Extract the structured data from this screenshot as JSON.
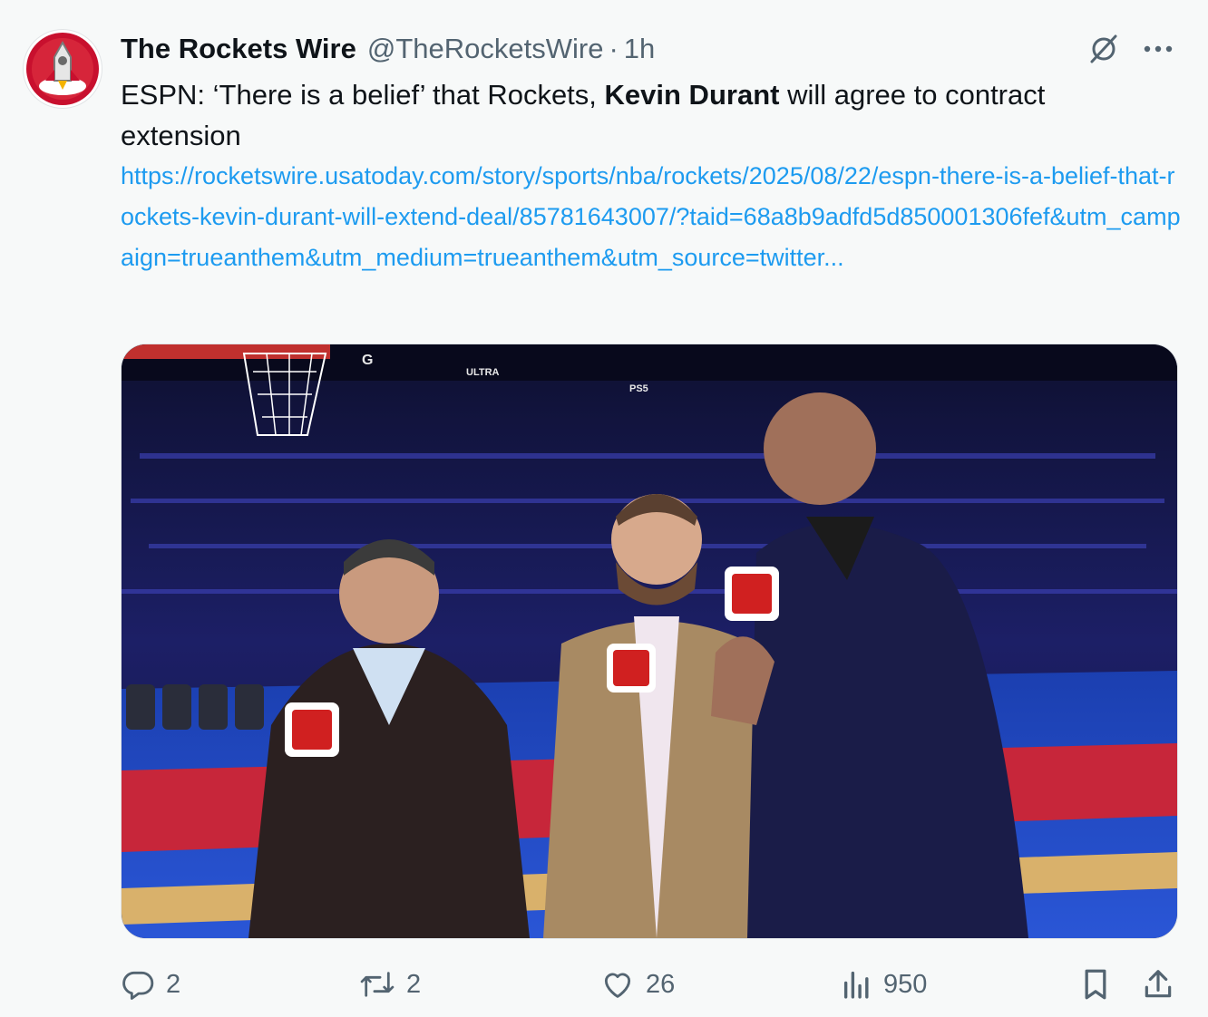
{
  "tweet": {
    "display_name": "The Rockets Wire",
    "handle": "@TheRocketsWire",
    "separator": "·",
    "time": "1h",
    "text_before": "ESPN: ‘There is a belief’ that Rockets, ",
    "text_bold": "Kevin Durant",
    "text_after": " will agree to contract extension",
    "link": "https://rocketswire.usatoday.com/story/sports/nba/rockets/2025/08/22/espn-there-is-a-belief-that-rockets-kevin-durant-will-extend-deal/85781643007/?taid=68a8b9adfd5d850001306fef&utm_campaign=trueanthem&utm_medium=trueanthem&utm_source=twitter..."
  },
  "media": {
    "arena_signage": [
      "G",
      "ULTRA",
      "PS5"
    ]
  },
  "actions": {
    "reply_count": "2",
    "retweet_count": "2",
    "like_count": "26",
    "views_count": "950"
  },
  "colors": {
    "link": "#1d9bf0",
    "muted": "#536471",
    "text": "#0f1419",
    "background": "#f7f9f9"
  },
  "icons": [
    "rockets-avatar-logo",
    "grok-icon",
    "more-icon",
    "reply-icon",
    "retweet-icon",
    "like-icon",
    "views-icon",
    "bookmark-icon",
    "share-icon"
  ]
}
